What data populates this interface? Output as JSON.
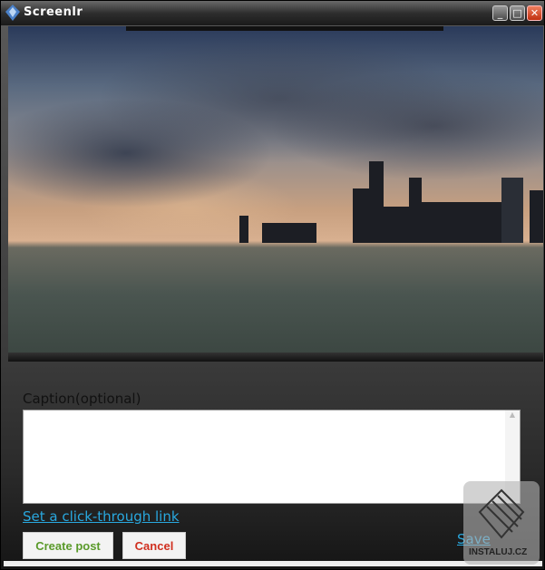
{
  "window": {
    "title": "Screenlr",
    "minimize": "_",
    "maximize": "□",
    "close": "✕"
  },
  "caption": {
    "label": "Caption(optional)",
    "value": "",
    "scroll_up": "▲"
  },
  "link_label": "Set a click-through link",
  "buttons": {
    "create": "Create post",
    "cancel": "Cancel",
    "save": "Save"
  },
  "colors": {
    "create": "#5a9a2a",
    "cancel": "#d03020",
    "link": "#29a8df"
  },
  "watermark": "INSTALUJ.CZ"
}
